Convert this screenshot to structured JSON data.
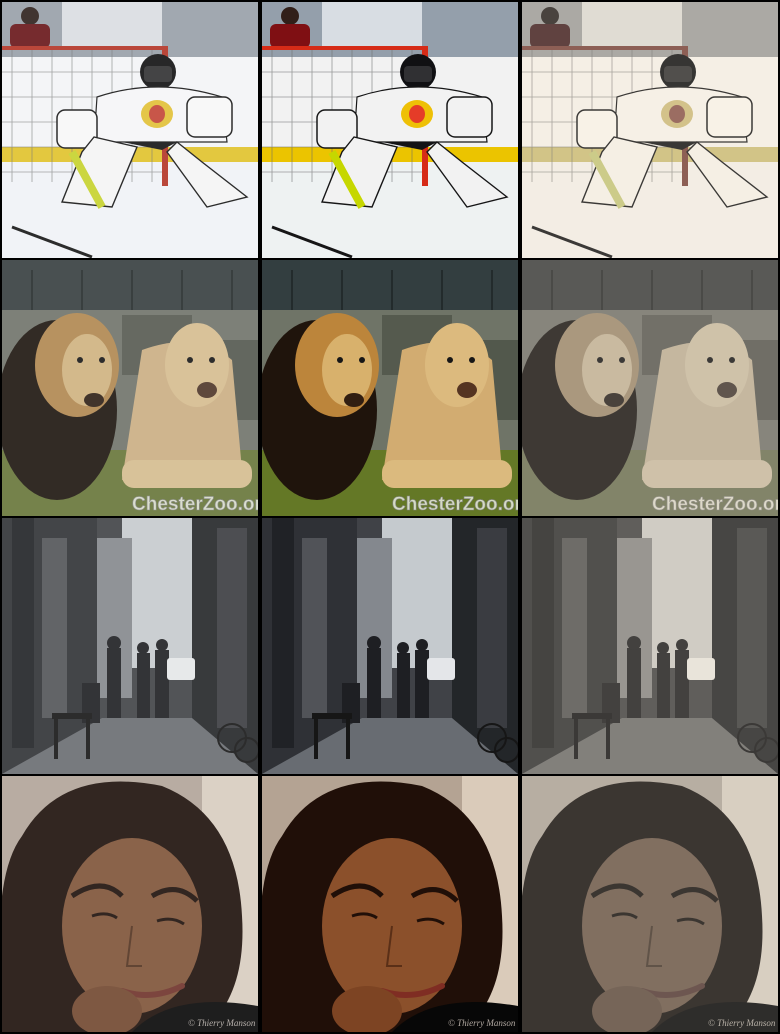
{
  "grid": {
    "rows": [
      {
        "subject": "hockey-goalie",
        "columns": [
          "hazy",
          "vivid",
          "faded"
        ],
        "watermark": "",
        "credit": ""
      },
      {
        "subject": "lions",
        "columns": [
          "hazy",
          "vivid",
          "faded"
        ],
        "watermark": "ChesterZoo.org",
        "credit": ""
      },
      {
        "subject": "street-arcade",
        "columns": [
          "hazy",
          "vivid",
          "faded"
        ],
        "watermark": "",
        "credit": ""
      },
      {
        "subject": "portrait-woman",
        "columns": [
          "hazy",
          "vivid",
          "faded"
        ],
        "watermark": "",
        "credit": "© Thierry Manson"
      }
    ]
  },
  "labels": {
    "lion_watermark": "ChesterZoo.org",
    "portrait_credit": "© Thierry Manson"
  },
  "colors": {
    "background": "#000000",
    "rink_ice": "#eef1f5",
    "rink_stripe": "#e3c21a",
    "jersey": "#f3f3f3",
    "lion_mane": "#2a211a",
    "lion_fur": "#c9a46a",
    "wall": "#5b5f58",
    "grass": "#6f7f3c",
    "street_stone": "#6b6e72",
    "sky": "#c8ccd0",
    "skin": "#8a5a3c",
    "hair": "#2a1c16"
  }
}
